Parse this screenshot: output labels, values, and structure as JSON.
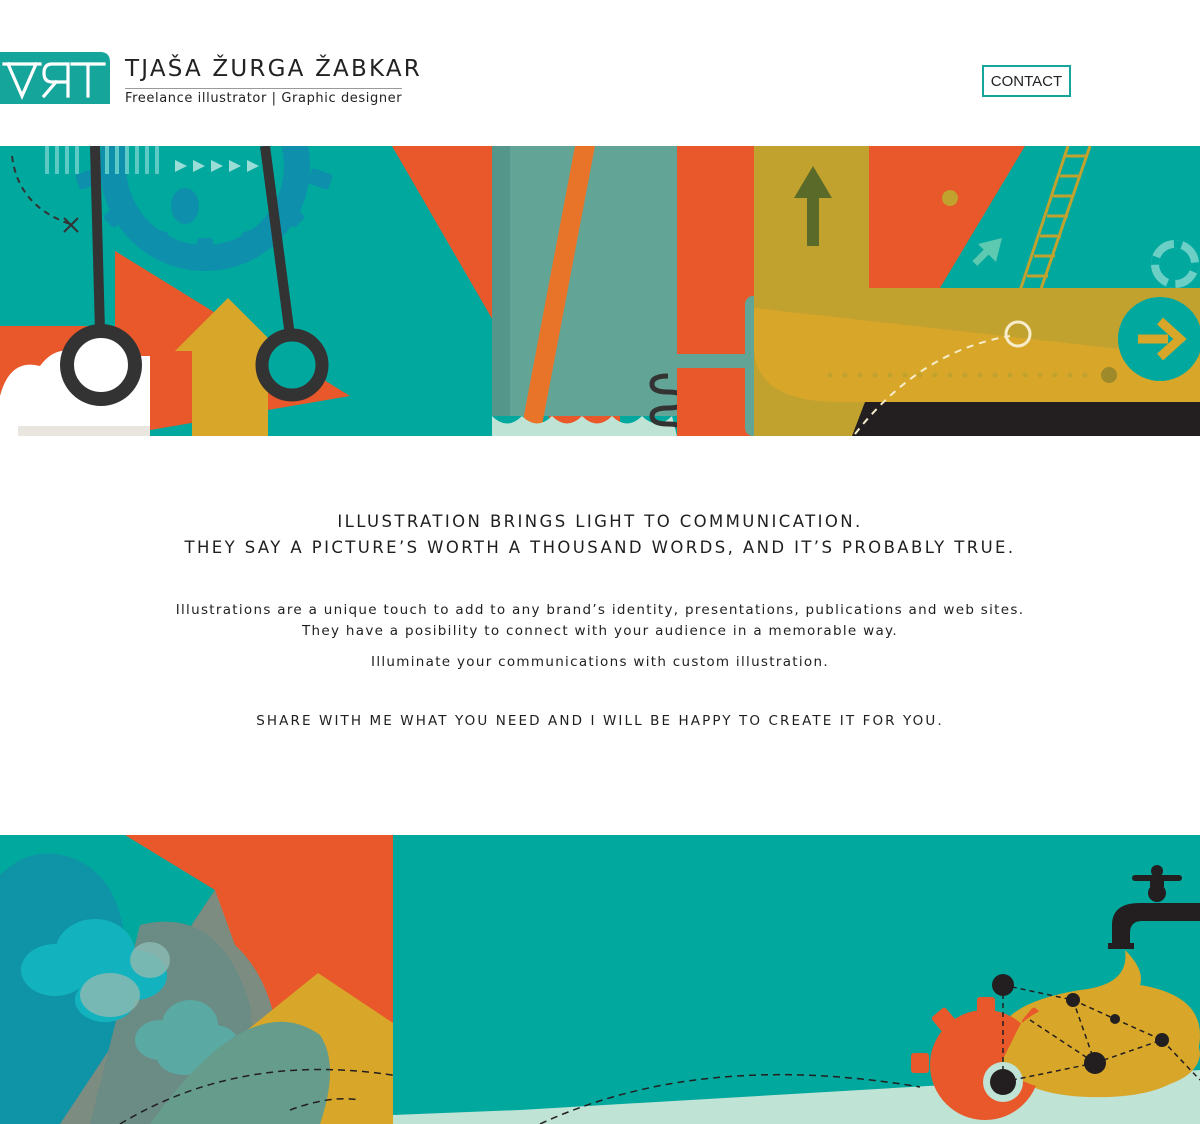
{
  "colors": {
    "teal": "#01a89e",
    "orange": "#e9582a",
    "mustard": "#d8a628",
    "olive": "#c2a22f",
    "dark": "#333333",
    "sage": "#62a596",
    "mint": "#bfe3d4"
  },
  "header": {
    "logo_text": "ART",
    "name": "TJAŠA ŽURGA ŽABKAR",
    "tagline": "Freelance illustrator | Graphic designer",
    "contact_label": "CONTACT"
  },
  "intro": {
    "headline_1": "ILLUSTRATION BRINGS LIGHT TO COMMUNICATION.",
    "headline_2": "THEY SAY A PICTURE’S WORTH A THOUSAND WORDS, AND IT’S PROBABLY TRUE.",
    "paragraph_1": "Illustrations are a unique touch to add to any brand’s identity, presentations, publications and web sites.",
    "paragraph_2": "They have a posibility to connect with your audience in a memorable way.",
    "paragraph_3": "Illuminate your communications with custom illustration.",
    "call_to_action": "SHARE WITH ME WHAT YOU NEED AND I WILL BE HAPPY TO CREATE IT FOR YOU."
  }
}
